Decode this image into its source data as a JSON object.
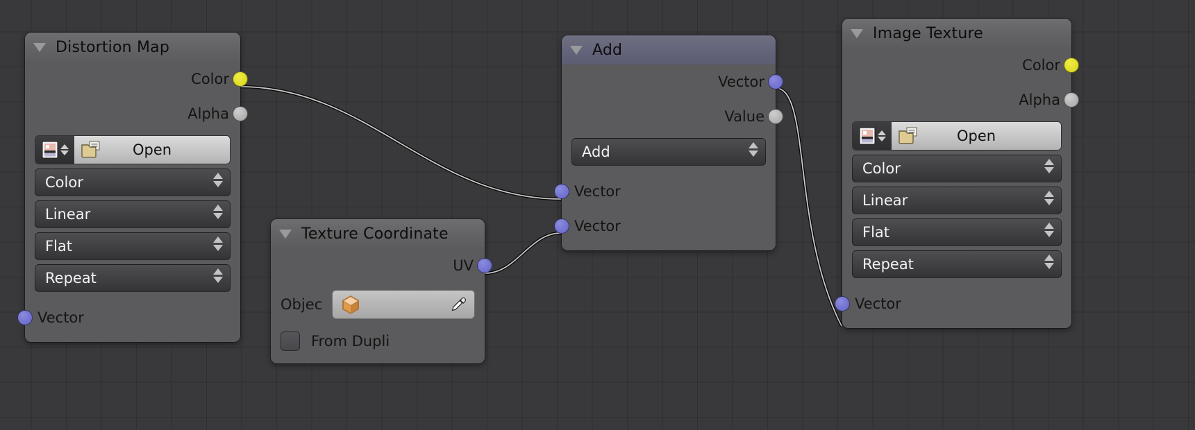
{
  "app": {
    "editor": "blender-shader-node-editor",
    "background_color": "#39393b",
    "grid_color": "#303032"
  },
  "socket_colors": {
    "color": "#dcd91e",
    "alpha": "#a2a2a2",
    "vector": "#6363c7"
  },
  "nodes": [
    {
      "id": "distortion-map",
      "title": "Distortion Map",
      "header_style": "gray",
      "outputs": [
        {
          "label": "Color",
          "type": "color"
        },
        {
          "label": "Alpha",
          "type": "alpha"
        }
      ],
      "image_selector": {
        "open_label": "Open",
        "thumb_icon": "image-thumbnail-icon",
        "folder_icon": "folder-icon"
      },
      "enums": [
        {
          "label": "Color"
        },
        {
          "label": "Linear"
        },
        {
          "label": "Flat"
        },
        {
          "label": "Repeat"
        }
      ],
      "inputs": [
        {
          "label": "Vector",
          "type": "vector"
        }
      ]
    },
    {
      "id": "texture-coordinate",
      "title": "Texture Coordinate",
      "header_style": "gray",
      "outputs": [
        {
          "label": "UV",
          "type": "vector"
        }
      ],
      "object_field": {
        "label": "Objec",
        "value": "",
        "object_icon": "object-cube-icon",
        "eyedropper_icon": "eyedropper-icon"
      },
      "checkbox": {
        "label": "From Dupli",
        "checked": false
      }
    },
    {
      "id": "add",
      "title": "Add",
      "header_style": "blue",
      "outputs": [
        {
          "label": "Vector",
          "type": "vector"
        },
        {
          "label": "Value",
          "type": "alpha"
        }
      ],
      "enums": [
        {
          "label": "Add"
        }
      ],
      "inputs": [
        {
          "label": "Vector",
          "type": "vector"
        },
        {
          "label": "Vector",
          "type": "vector"
        }
      ]
    },
    {
      "id": "image-texture",
      "title": "Image Texture",
      "header_style": "gray",
      "outputs": [
        {
          "label": "Color",
          "type": "color"
        },
        {
          "label": "Alpha",
          "type": "alpha"
        }
      ],
      "image_selector": {
        "open_label": "Open",
        "thumb_icon": "image-thumbnail-icon",
        "folder_icon": "folder-icon"
      },
      "enums": [
        {
          "label": "Color"
        },
        {
          "label": "Linear"
        },
        {
          "label": "Flat"
        },
        {
          "label": "Repeat"
        }
      ],
      "inputs": [
        {
          "label": "Vector",
          "type": "vector"
        }
      ]
    }
  ],
  "links": [
    {
      "from": "distortion-map.Color",
      "to": "add.Vector-1"
    },
    {
      "from": "texture-coordinate.UV",
      "to": "add.Vector-2"
    },
    {
      "from": "add.Vector",
      "to": "image-texture.Vector"
    }
  ]
}
